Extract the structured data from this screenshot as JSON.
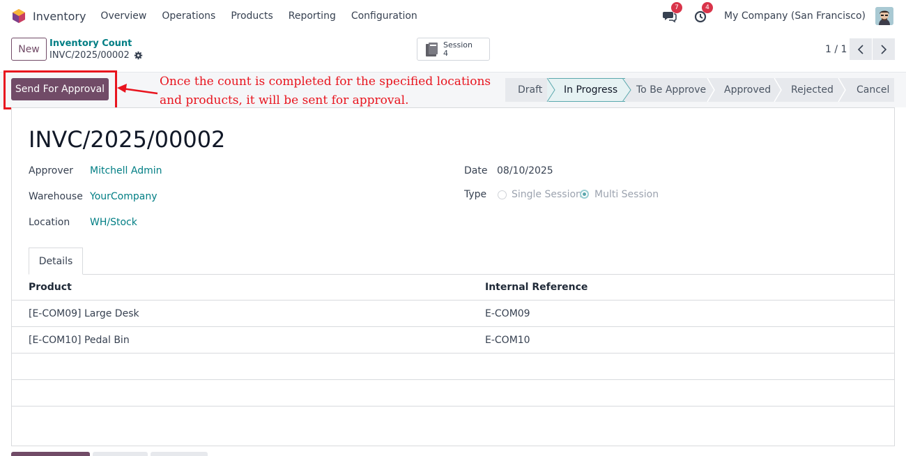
{
  "navbar": {
    "app_name": "Inventory",
    "menu": [
      "Overview",
      "Operations",
      "Products",
      "Reporting",
      "Configuration"
    ],
    "messages_badge": "7",
    "activities_badge": "4",
    "company": "My Company (San Francisco)"
  },
  "control": {
    "new_label": "New",
    "breadcrumb_parent": "Inventory Count",
    "breadcrumb_current": "INVC/2025/00002",
    "session_label": "Session",
    "session_count": "4",
    "pager": "1 / 1"
  },
  "actions": {
    "send_label": "Send For Approval",
    "annotation_line1": "Once the count is completed for the specified locations",
    "annotation_line2": "and products, it will be sent for approval."
  },
  "stages": [
    {
      "label": "Draft",
      "active": false
    },
    {
      "label": "In Progress",
      "active": true
    },
    {
      "label": "To Be Approve",
      "active": false
    },
    {
      "label": "Approved",
      "active": false
    },
    {
      "label": "Rejected",
      "active": false
    },
    {
      "label": "Cancel",
      "active": false
    }
  ],
  "record": {
    "title": "INVC/2025/00002",
    "approver_label": "Approver",
    "approver": "Mitchell Admin",
    "warehouse_label": "Warehouse",
    "warehouse": "YourCompany",
    "location_label": "Location",
    "location": "WH/Stock",
    "date_label": "Date",
    "date": "08/10/2025",
    "type_label": "Type",
    "type_options": [
      "Single Session",
      "Multi Session"
    ],
    "type_selected": "Multi Session"
  },
  "tabs": {
    "details": "Details"
  },
  "table": {
    "columns": [
      "Product",
      "Internal Reference"
    ],
    "rows": [
      [
        "[E-COM09] Large Desk",
        "E-COM09"
      ],
      [
        "[E-COM10] Pedal Bin",
        "E-COM10"
      ]
    ]
  },
  "colors": {
    "brand": "#714B67",
    "link": "#017e84",
    "annotation": "#e8141e"
  }
}
